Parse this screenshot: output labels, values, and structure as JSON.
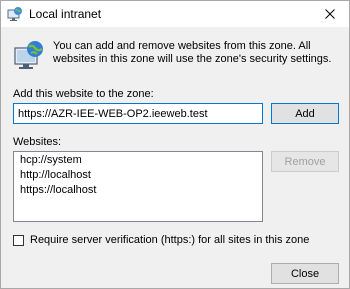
{
  "window": {
    "title": "Local intranet",
    "close_glyph": "✕"
  },
  "description": "You can add and remove websites from this zone. All websites in this zone will use the zone's security settings.",
  "add_section": {
    "label": "Add this website to the zone:",
    "input_value": "https://AZR-IEE-WEB-OP2.ieeweb.test",
    "add_button": "Add"
  },
  "websites_section": {
    "label": "Websites:",
    "items": [
      "hcp://system",
      "http://localhost",
      "https://localhost"
    ],
    "remove_button": "Remove"
  },
  "verification": {
    "label": "Require server verification (https:) for all sites in this zone",
    "checked": false
  },
  "close_button": "Close",
  "icons": {
    "title": "globe-monitor-icon",
    "zone": "globe-monitor-icon",
    "close": "close-icon"
  },
  "colors": {
    "accent": "#0078d7",
    "dialog_bg": "#f0f0f0",
    "disabled_text": "#a0a0a0"
  }
}
